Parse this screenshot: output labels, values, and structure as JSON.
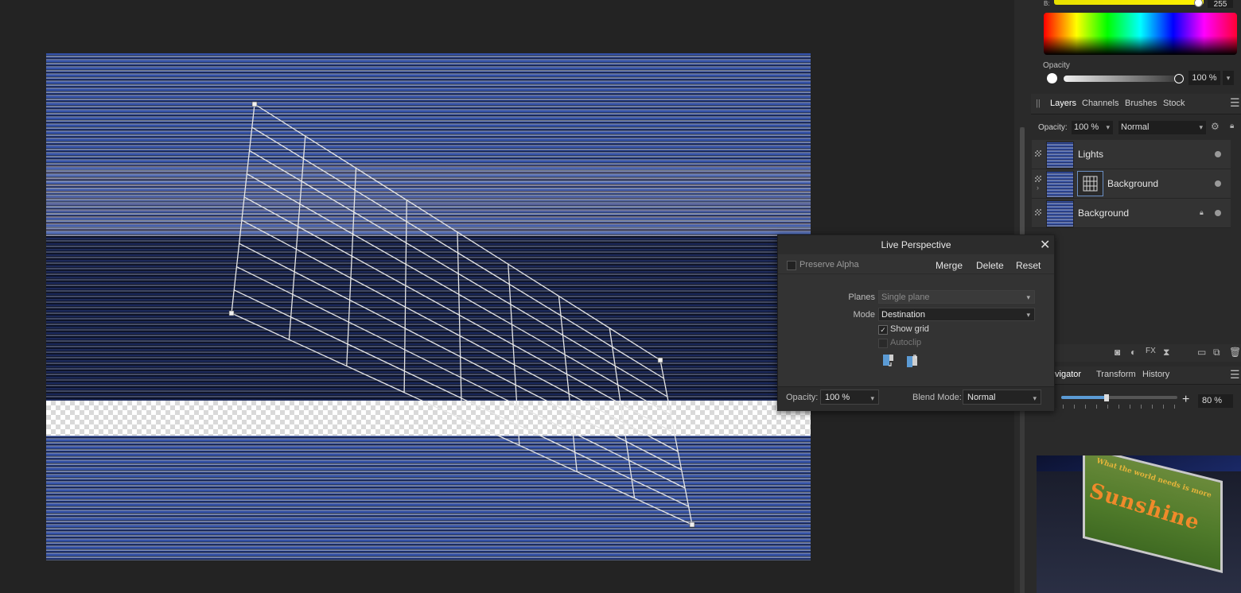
{
  "color_panel": {
    "b_label": "B:",
    "b_value": "255",
    "opacity_label": "Opacity",
    "opacity_value": "100 %"
  },
  "studio_tabs": {
    "layers": "Layers",
    "channels": "Channels",
    "brushes": "Brushes",
    "stock": "Stock"
  },
  "layers_panel": {
    "opacity_label": "Opacity:",
    "opacity_value": "100 %",
    "blend_mode": "Normal",
    "layers": [
      {
        "name": "Lights"
      },
      {
        "name": "Background"
      },
      {
        "name": "Background"
      }
    ]
  },
  "navigator_tabs": {
    "navigator": "Navigator",
    "transform": "Transform",
    "history": "History"
  },
  "navigator": {
    "zoom_value": "80 %",
    "preview_text_small": "What the world needs is more",
    "preview_text_big": "Sunshine"
  },
  "live_perspective": {
    "title": "Live Perspective",
    "preserve_alpha": "Preserve Alpha",
    "merge": "Merge",
    "delete": "Delete",
    "reset": "Reset",
    "planes_label": "Planes",
    "planes_value": "Single plane",
    "mode_label": "Mode",
    "mode_value": "Destination",
    "show_grid": "Show grid",
    "autoclip": "Autoclip",
    "opacity_label": "Opacity:",
    "opacity_value": "100 %",
    "blend_label": "Blend Mode:",
    "blend_value": "Normal"
  },
  "icons": {
    "close": "close-icon",
    "settings": "gear-icon",
    "lock": "lock-icon",
    "menu": "hamburger-icon"
  },
  "colors": {
    "accent": "#5b9bd5",
    "panel_bg": "#2a2a2a",
    "dialog_bg": "#333333"
  }
}
